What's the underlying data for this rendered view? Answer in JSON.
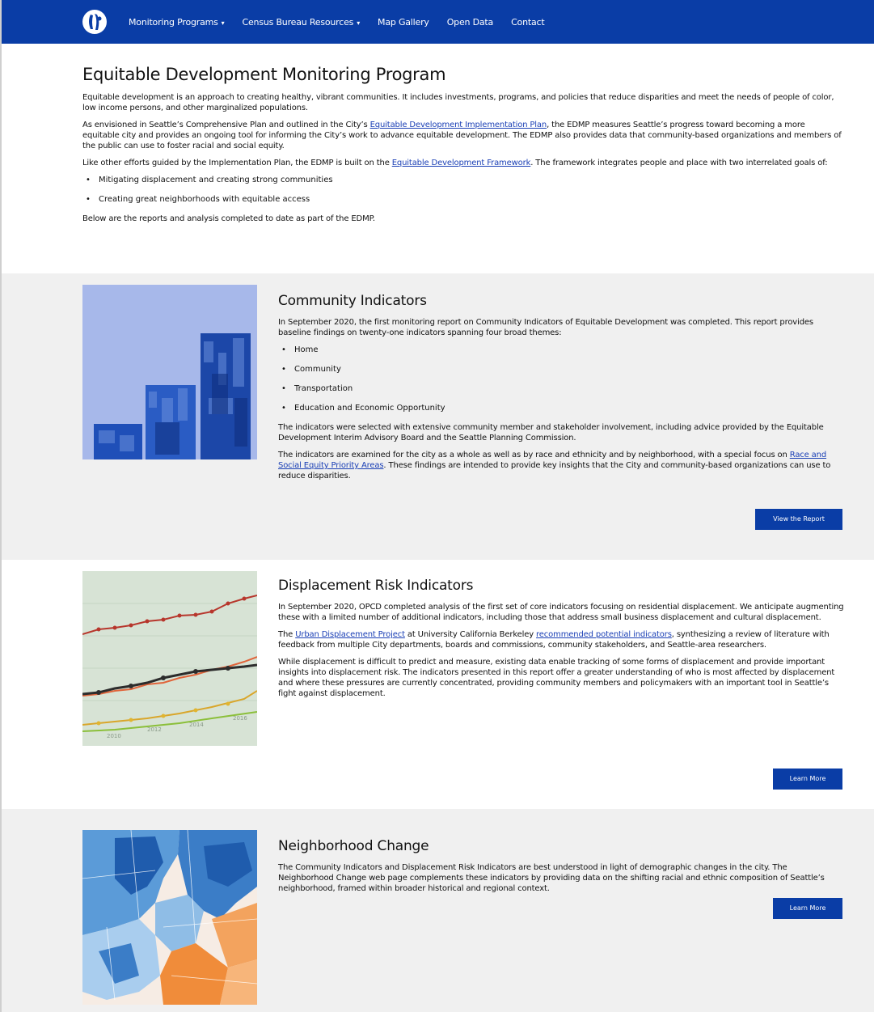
{
  "nav": {
    "items": [
      {
        "label": "Monitoring Programs",
        "caret": "▾"
      },
      {
        "label": "Census Bureau Resources",
        "caret": "▾"
      },
      {
        "label": "Map Gallery"
      },
      {
        "label": "Open Data"
      },
      {
        "label": "Contact"
      }
    ]
  },
  "intro": {
    "title": "Equitable Development Monitoring Program",
    "p1": "Equitable development is an approach to creating healthy, vibrant communities. It includes investments, programs, and policies that reduce disparities and meet the needs of people of color, low income persons, and other marginalized populations.",
    "p2_before": "As envisioned in Seattle’s Comprehensive Plan and outlined in the City’s ",
    "p2_link": "Equitable Development Implementation Plan",
    "p2_after": ", the EDMP measures Seattle’s progress toward becoming a more equitable city and provides an ongoing tool for informing the City’s work to advance equitable development. The EDMP also provides data that community-based organizations and members of the public can use to foster racial and social equity.",
    "p3_before": "Like other efforts guided by the Implementation Plan, the EDMP is built on the ",
    "p3_link": "Equitable Development Framework",
    "p3_after": ". The framework integrates people and place with two interrelated goals of:",
    "goals": [
      "Mitigating displacement and creating strong communities",
      "Creating great neighborhoods with equitable access"
    ],
    "p4": "Below are the reports and analysis completed to date as part of the EDMP."
  },
  "community": {
    "title": "Community Indicators",
    "p1": "In September 2020, the first monitoring report on Community Indicators of Equitable Development was completed. This report provides baseline findings on twenty-one indicators spanning four broad themes:",
    "themes": [
      "Home",
      "Community",
      "Transportation",
      "Education and Economic Opportunity"
    ],
    "p2": "The indicators were selected with extensive community member and stakeholder involvement, including advice provided by the Equitable Development Interim Advisory Board and the Seattle Planning Commission.",
    "p3_before": "The indicators are examined for the city as a whole as well as by race and ethnicity and by neighborhood, with a special focus on ",
    "p3_link": "Race and Social Equity Priority Areas",
    "p3_after": ". These findings are intended to provide key insights that the City and community-based organizations can use to reduce disparities.",
    "button": "View the Report",
    "color_bg": "#a7b8ea",
    "color_bar": "#1f4fb8"
  },
  "displacement": {
    "title": "Displacement Risk Indicators",
    "p1": "In September 2020, OPCD completed analysis of the first set of core indicators focusing on residential displacement. We anticipate augmenting these with a limited number of additional indicators, including those that address small business displacement and cultural displacement.",
    "p2_before": "The ",
    "p2_link1": "Urban Displacement Project",
    "p2_mid": " at University California Berkeley ",
    "p2_link2": "recommended potential indicators",
    "p2_after": ", synthesizing a review of literature with feedback from multiple City departments, boards and commissions, community stakeholders, and Seattle-area researchers.",
    "p3": "While displacement is difficult to predict and measure, existing data enable tracking of some forms of displacement and provide important insights into displacement risk. The indicators presented in this report offer a greater understanding of who is most affected by displacement and where these pressures are currently concentrated, providing community members and policymakers with an important tool in Seattle’s fight against displacement.",
    "button": "Learn More",
    "years": [
      "2010",
      "2012",
      "2014",
      "2016"
    ]
  },
  "neighborhood": {
    "title": "Neighborhood Change",
    "p1": "The Community Indicators and Displacement Risk Indicators are best understood in light of demographic changes in the city. The Neighborhood Change web page complements these indicators by providing data on the shifting racial and ethnic composition of Seattle’s neighborhood, framed within broader historical and regional context.",
    "button": "Learn More"
  },
  "colors": {
    "nav": "#0a3da6",
    "link": "#1a3fb5",
    "section_bg": "#f0f0f0"
  }
}
